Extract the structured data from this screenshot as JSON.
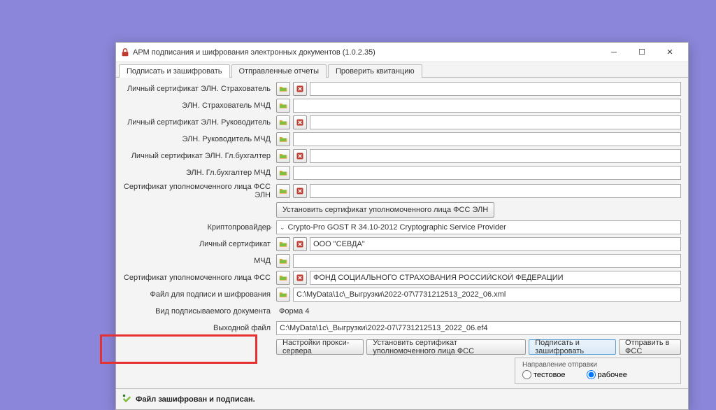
{
  "window": {
    "title": "АРМ подписания и шифрования электронных документов (1.0.2.35)"
  },
  "tabs": [
    "Подписать и зашифровать",
    "Отправленные отчеты",
    "Проверить квитанцию"
  ],
  "labels": {
    "cert_eln_insurer": "Личный сертификат ЭЛН. Страхователь",
    "eln_insurer_mchd": "ЭЛН. Страхователь МЧД",
    "cert_eln_head": "Личный сертификат ЭЛН. Руководитель",
    "eln_head_mchd": "ЭЛН. Руководитель МЧД",
    "cert_eln_accountant": "Личный сертификат ЭЛН. Гл.бухгалтер",
    "eln_accountant_mchd": "ЭЛН. Гл.бухгалтер МЧД",
    "cert_auth_fss_eln": "Сертификат уполномоченного лица ФСС ЭЛН",
    "cryptoprovider": "Криптопровайдер",
    "personal_cert": "Личный сертификат",
    "mchd": "МЧД",
    "cert_auth_fss": "Сертификат уполномоченного лица ФСС",
    "file_for_sign": "Файл для подписи и шифрования",
    "doc_type": "Вид подписываемого документа",
    "output_file": "Выходной файл"
  },
  "values": {
    "cryptoprovider": "Crypto-Pro GOST R 34.10-2012 Cryptographic Service Provider",
    "personal_cert": "ООО \"СЕВДА\"",
    "cert_auth_fss": "ФОНД СОЦИАЛЬНОГО СТРАХОВАНИЯ РОССИЙСКОЙ ФЕДЕРАЦИИ",
    "file_for_sign": "C:\\MyData\\1c\\_Выгрузки\\2022-07\\7731212513_2022_06.xml",
    "doc_type": "Форма 4",
    "output_file": "C:\\MyData\\1c\\_Выгрузки\\2022-07\\7731212513_2022_06.ef4"
  },
  "buttons": {
    "install_cert_eln": "Установить сертификат уполномоченного лица ФСС ЭЛН",
    "proxy_settings": "Настройки прокси-сервера",
    "install_cert_fss": "Установить сертификат уполномоченного лица ФСС",
    "sign_encrypt": "Подписать и зашифровать",
    "send_to_fss": "Отправить в ФСС"
  },
  "radio": {
    "title": "Направление отправки",
    "test": "тестовое",
    "work": "рабочее"
  },
  "status": "Файл зашифрован и подписан."
}
